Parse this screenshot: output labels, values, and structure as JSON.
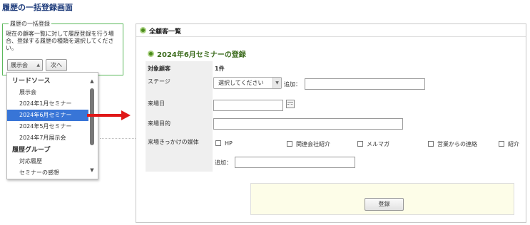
{
  "page_title": "履歴の一括登録画面",
  "bulk_panel": {
    "legend": "履歴の一括登録",
    "description": "現在の顧客一覧に対して履歴登録を行う場合、登録する履歴の種類を選択してください。",
    "selected_type": "展示会",
    "next_button": "次へ"
  },
  "dropdown": {
    "groups": [
      {
        "label": "リードソース",
        "items": [
          "展示会",
          "2024年1月セミナー",
          "2024年6月セミナー",
          "2024年5月セミナー",
          "2024年7月展示会"
        ]
      },
      {
        "label": "履歴グループ",
        "items": [
          "対応履歴",
          "セミナーの感想"
        ]
      }
    ],
    "selected_item": "2024年6月セミナー"
  },
  "main_panel": {
    "header_title": "全顧客一覧",
    "section_title": "2024年6月セミナーの登録",
    "target_label": "対象顧客",
    "target_value": "1件",
    "stage_label": "ステージ",
    "stage_placeholder": "選択してください",
    "stage_add_label": "追加：",
    "visit_date_label": "来場日",
    "visit_purpose_label": "来場目的",
    "media_label": "来場きっかけの媒体",
    "media_options": [
      "HP",
      "関連会社紹介",
      "メルマガ",
      "営業からの連絡",
      "紹介"
    ],
    "media_add_label": "追加：",
    "submit_button": "登録"
  },
  "colors": {
    "title_blue": "#1c3a7a",
    "section_green": "#3b6b1c",
    "fieldset_border": "#5cb85c",
    "selection_blue": "#3875d7",
    "arrow_red": "#e01818",
    "submit_bg": "#fdfde8"
  }
}
